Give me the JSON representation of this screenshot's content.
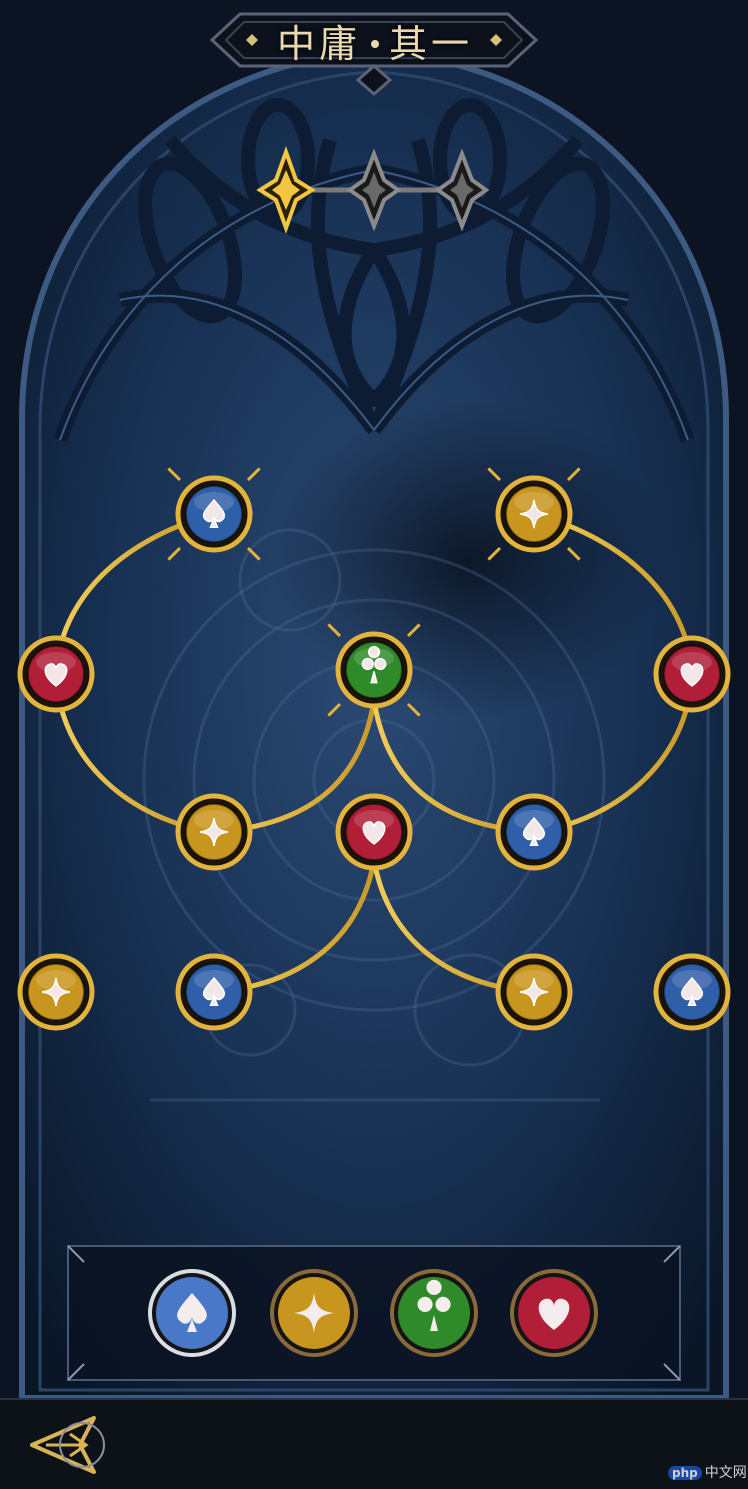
{
  "title": {
    "left": "中庸",
    "right": "其一"
  },
  "progress": {
    "total_stars": 3,
    "unlocked_stars": 1
  },
  "tree": {
    "nodes": [
      {
        "id": "n1",
        "suit": "spade",
        "color": "#2f5fa8",
        "locked": true
      },
      {
        "id": "n2",
        "suit": "diamond",
        "color": "#c8961e",
        "locked": true
      },
      {
        "id": "n3",
        "suit": "heart",
        "color": "#b01e38",
        "locked": false
      },
      {
        "id": "n4",
        "suit": "heart",
        "color": "#b01e38",
        "locked": false
      },
      {
        "id": "n5",
        "suit": "club",
        "color": "#2f8a2a",
        "locked": true
      },
      {
        "id": "n6",
        "suit": "diamond",
        "color": "#c8961e",
        "locked": false
      },
      {
        "id": "n7",
        "suit": "heart",
        "color": "#b01e38",
        "locked": false
      },
      {
        "id": "n8",
        "suit": "spade",
        "color": "#2f5fa8",
        "locked": false
      },
      {
        "id": "n9",
        "suit": "diamond",
        "color": "#c8961e",
        "locked": false
      },
      {
        "id": "n10",
        "suit": "spade",
        "color": "#2f5fa8",
        "locked": false
      },
      {
        "id": "n11",
        "suit": "diamond",
        "color": "#c8961e",
        "locked": false
      },
      {
        "id": "n12",
        "suit": "spade",
        "color": "#2f5fa8",
        "locked": false
      }
    ]
  },
  "suit_palette": [
    {
      "suit": "spade",
      "color": "#4a78c8"
    },
    {
      "suit": "diamond",
      "color": "#c8961e"
    },
    {
      "suit": "club",
      "color": "#2f8a2a"
    },
    {
      "suit": "heart",
      "color": "#b01e38"
    }
  ],
  "colors": {
    "gold": "#e3b43c",
    "panel": "#10203a"
  },
  "watermark": {
    "badge": "php",
    "text": "中文网"
  }
}
